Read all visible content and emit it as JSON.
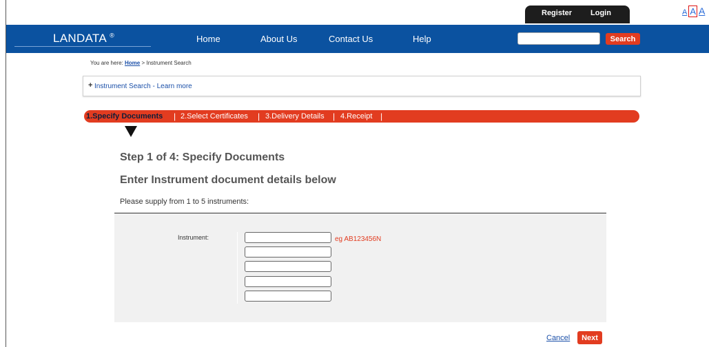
{
  "userbar": {
    "register": "Register",
    "login": "Login"
  },
  "textsize": {
    "small": "A",
    "medium": "A",
    "large": "A"
  },
  "nav": {
    "logo": "LANDATA",
    "logo_mark": "®",
    "items": [
      "Home",
      "About Us",
      "Contact Us",
      "Help"
    ],
    "search_value": "",
    "search_button": "Search"
  },
  "breadcrumb": {
    "prefix": "You are here:",
    "home": "Home",
    "current": "> Instrument Search"
  },
  "learn_more": {
    "plus": "+",
    "label": "Instrument Search - Learn more"
  },
  "steps": {
    "items": [
      "1.Specify Documents",
      "2.Select Certificates",
      "3.Delivery Details",
      "4.Receipt"
    ],
    "separator": "|",
    "active_index": 0
  },
  "content": {
    "step_heading": "Step 1 of 4: Specify Documents",
    "enter_heading": "Enter Instrument document details below",
    "supply_text": "Please supply from 1 to 5 instruments:",
    "instrument_label": "Instrument:",
    "example": "eg AB123456N",
    "instrument_values": [
      "",
      "",
      "",
      "",
      ""
    ]
  },
  "actions": {
    "cancel": "Cancel",
    "next": "Next"
  },
  "colors": {
    "nav_blue": "#0b52a0",
    "accent_red": "#e23c20",
    "userbar_black": "#1d1d1d"
  }
}
